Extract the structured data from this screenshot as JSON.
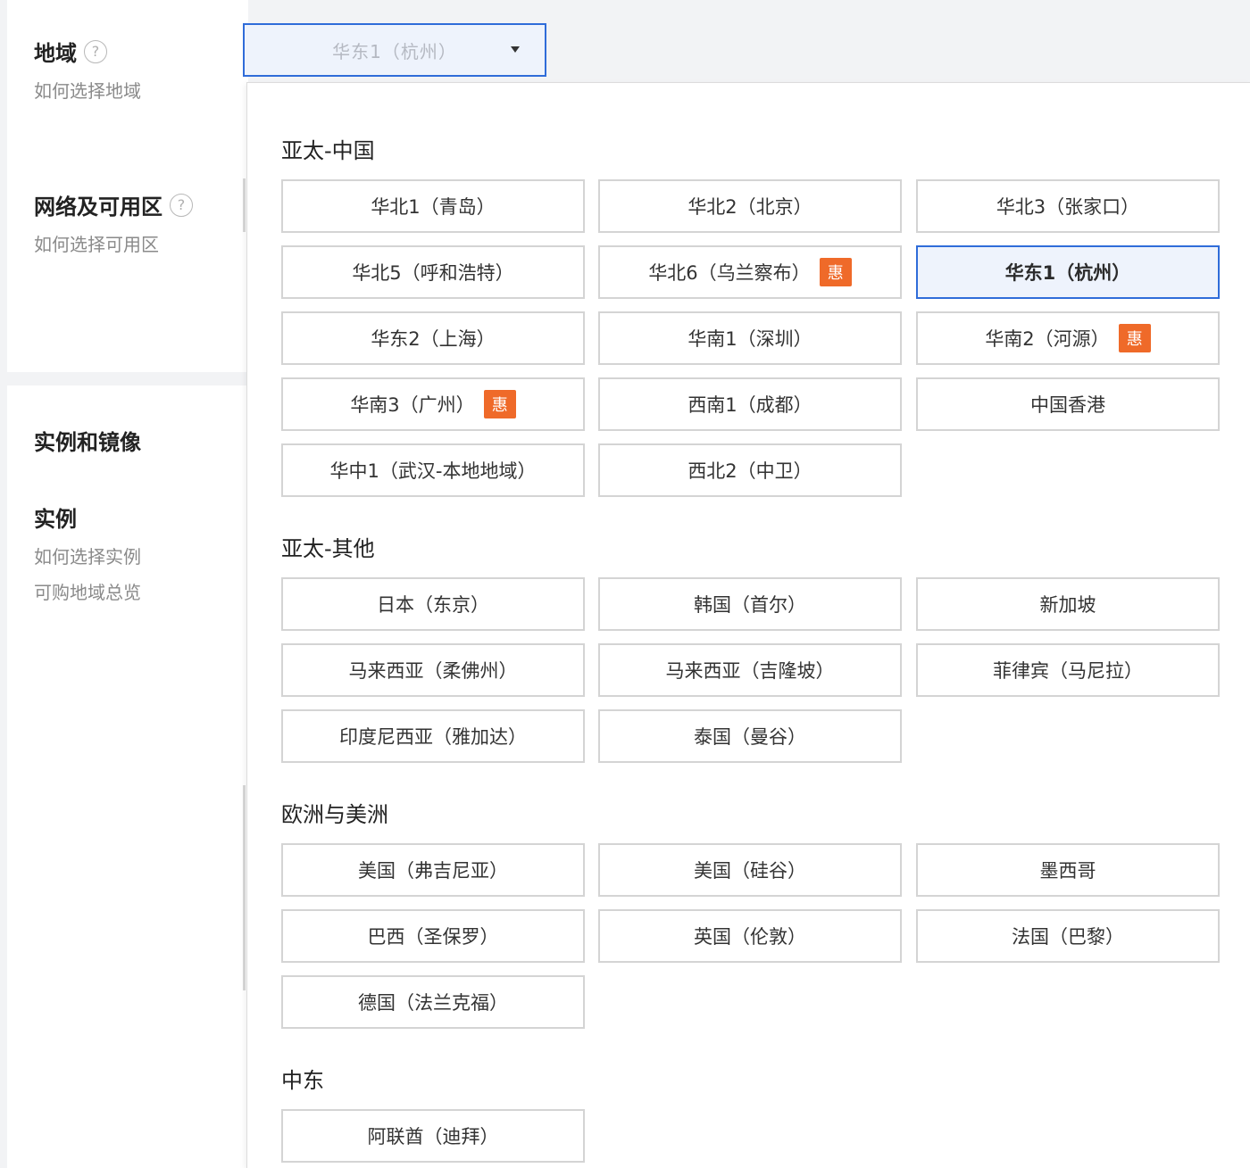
{
  "sidebar": {
    "region_title": "地域",
    "region_help": "?",
    "region_link": "如何选择地域",
    "network_title": "网络及可用区",
    "network_help": "?",
    "network_link": "如何选择可用区",
    "instance_image_title": "实例和镜像",
    "instance_title": "实例",
    "instance_link": "如何选择实例",
    "region_overview_link": "可购地域总览"
  },
  "region_select": {
    "value": "华东1（杭州）",
    "caret_icon": "caret-down-icon"
  },
  "badge_text": "惠",
  "groups": [
    {
      "title": "亚太-中国",
      "items": [
        {
          "label": "华北1（青岛）"
        },
        {
          "label": "华北2（北京）"
        },
        {
          "label": "华北3（张家口）"
        },
        {
          "label": "华北5（呼和浩特）"
        },
        {
          "label": "华北6（乌兰察布）",
          "badge": true
        },
        {
          "label": "华东1（杭州）",
          "selected": true
        },
        {
          "label": "华东2（上海）"
        },
        {
          "label": "华南1（深圳）"
        },
        {
          "label": "华南2（河源）",
          "badge": true
        },
        {
          "label": "华南3（广州）",
          "badge": true
        },
        {
          "label": "西南1（成都）"
        },
        {
          "label": "中国香港"
        },
        {
          "label": "华中1（武汉-本地地域）"
        },
        {
          "label": "西北2（中卫）"
        }
      ]
    },
    {
      "title": "亚太-其他",
      "items": [
        {
          "label": "日本（东京）"
        },
        {
          "label": "韩国（首尔）"
        },
        {
          "label": "新加坡"
        },
        {
          "label": "马来西亚（柔佛州）"
        },
        {
          "label": "马来西亚（吉隆坡）"
        },
        {
          "label": "菲律宾（马尼拉）"
        },
        {
          "label": "印度尼西亚（雅加达）"
        },
        {
          "label": "泰国（曼谷）"
        }
      ]
    },
    {
      "title": "欧洲与美洲",
      "items": [
        {
          "label": "美国（弗吉尼亚）"
        },
        {
          "label": "美国（硅谷）"
        },
        {
          "label": "墨西哥"
        },
        {
          "label": "巴西（圣保罗）"
        },
        {
          "label": "英国（伦敦）"
        },
        {
          "label": "法国（巴黎）"
        },
        {
          "label": "德国（法兰克福）"
        }
      ]
    },
    {
      "title": "中东",
      "items": [
        {
          "label": "阿联酋（迪拜）"
        }
      ]
    }
  ],
  "colors": {
    "accent": "#2f6cd9",
    "selected_bg": "#eef3fc",
    "badge": "#ef6a29"
  }
}
